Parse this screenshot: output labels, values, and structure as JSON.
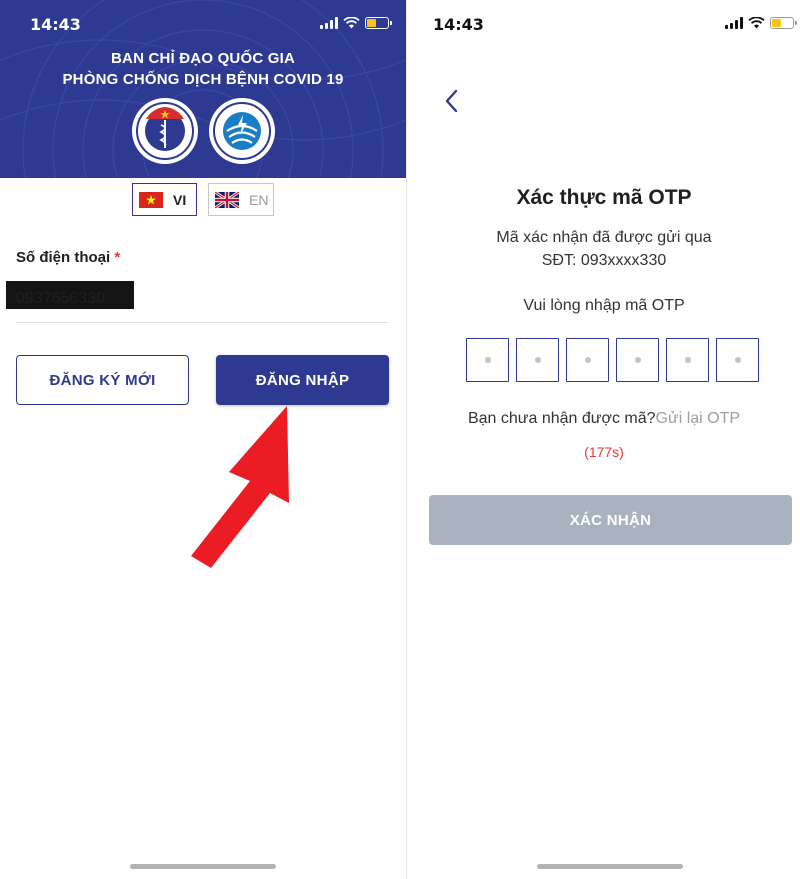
{
  "colors": {
    "primary": "#2e3a91",
    "required": "#e53935",
    "disabled_button": "#a8b3bf",
    "muted_text": "#9e9e9e",
    "countdown": "#e53935"
  },
  "left_screen": {
    "status_bar": {
      "time": "14:43",
      "icons": [
        "signal-icon",
        "wifi-icon",
        "battery-low-icon"
      ]
    },
    "header": {
      "title_line1": "BAN CHỈ ĐẠO QUỐC GIA",
      "title_line2": "PHÒNG CHỐNG DỊCH BỆNH COVID 19",
      "logos": [
        "ministry-of-health-logo",
        "ministry-of-information-logo"
      ]
    },
    "language": {
      "selected": "VI",
      "options": [
        {
          "code": "VI",
          "icon": "vietnam-flag-icon"
        },
        {
          "code": "EN",
          "icon": "uk-flag-icon"
        }
      ]
    },
    "phone_field": {
      "label": "Số điện thoại",
      "required_mark": "*",
      "value": "0937656330"
    },
    "register_button": "ĐĂNG KÝ MỚI",
    "login_button": "ĐĂNG NHẬP"
  },
  "right_screen": {
    "status_bar": {
      "time": "14:43",
      "icons": [
        "signal-icon",
        "wifi-icon",
        "battery-low-icon"
      ]
    },
    "back_icon": "chevron-left-icon",
    "title": "Xác thực mã OTP",
    "sent_line": "Mã xác nhận đã được gửi qua",
    "phone_line": "SĐT:  093xxxx330",
    "instruction": "Vui lòng nhập mã OTP",
    "otp_length": 6,
    "resend_prompt": "Bạn chưa nhận được mã?",
    "resend_link": "Gửi lại OTP",
    "countdown": "(177s)",
    "confirm_button": "XÁC NHẬN"
  }
}
